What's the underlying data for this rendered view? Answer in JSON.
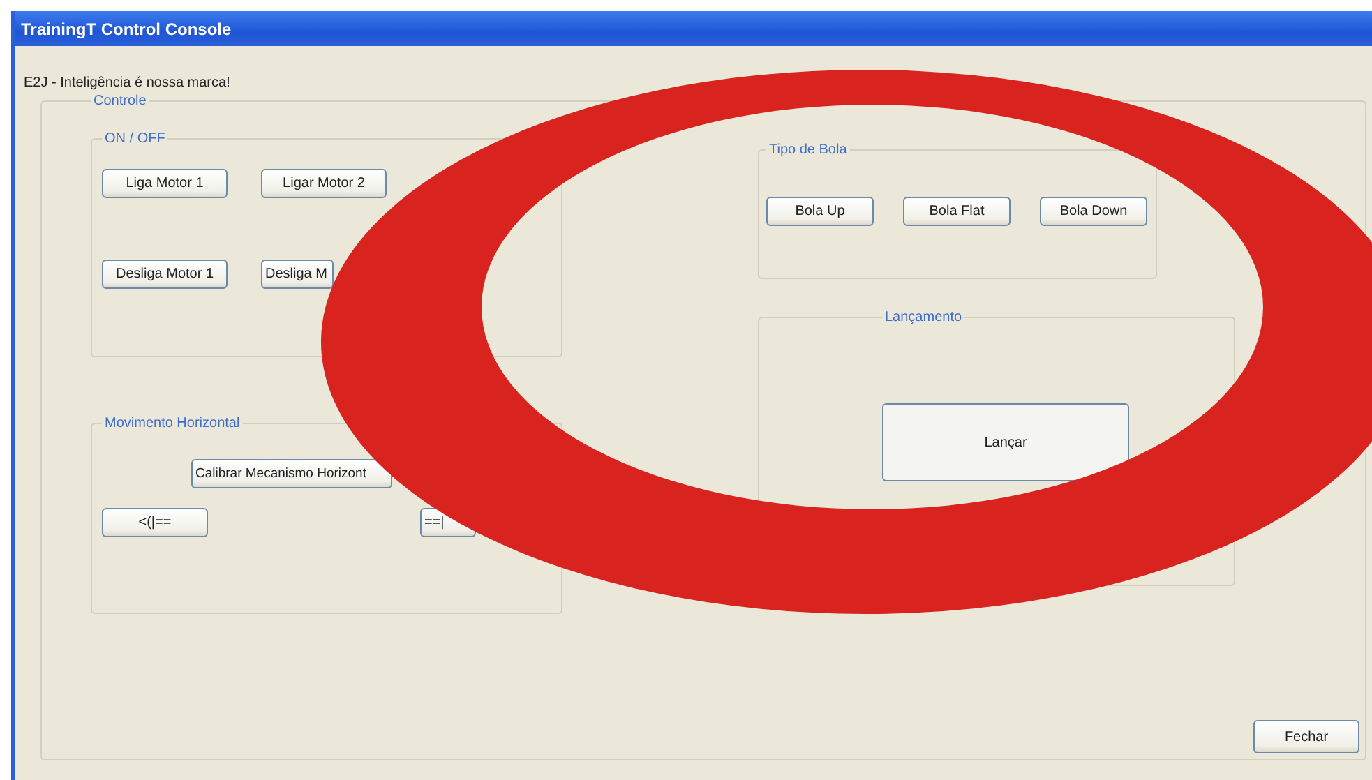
{
  "window": {
    "title": "TrainingT Control Console"
  },
  "slogan": "E2J - Inteligência é nossa marca!",
  "controle": {
    "label": "Controle",
    "on_off": {
      "label": "ON / OFF",
      "buttons": [
        "Liga Motor 1",
        "Ligar Motor 2",
        "Desliga Motor 1",
        "Desliga M"
      ]
    },
    "movimento_horizontal": {
      "label": "Movimento Horizontal",
      "buttons": [
        "Calibrar Mecanismo Horizont",
        "<(|==",
        "==|"
      ]
    },
    "tipo_de_bola": {
      "label": "Tipo de Bola",
      "buttons": [
        "Bola Up",
        "Bola Flat",
        "Bola Down"
      ]
    },
    "lancamento": {
      "label": "Lançamento",
      "buttons": [
        "Lançar"
      ]
    }
  },
  "buttons": [
    "Fechar"
  ]
}
